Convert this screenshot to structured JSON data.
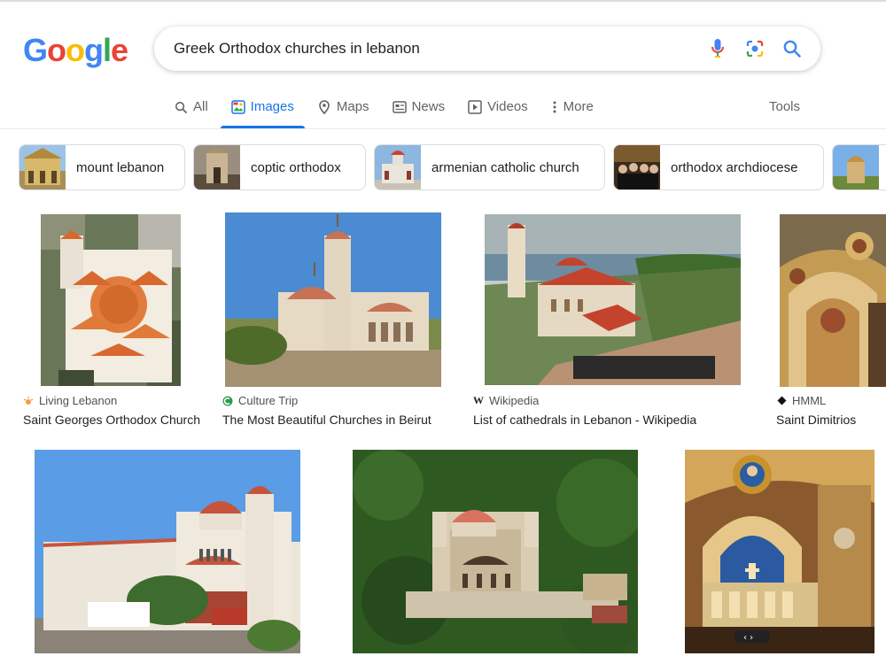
{
  "search": {
    "query": "Greek Orthodox churches in lebanon"
  },
  "logo": {
    "letters": [
      "G",
      "o",
      "o",
      "g",
      "l",
      "e"
    ],
    "colors": [
      "#4285F4",
      "#EA4335",
      "#FBBC05",
      "#4285F4",
      "#34A853",
      "#EA4335"
    ]
  },
  "tabs": [
    {
      "label": "All",
      "icon": "search-icon"
    },
    {
      "label": "Images",
      "icon": "images-icon"
    },
    {
      "label": "Maps",
      "icon": "map-pin-icon"
    },
    {
      "label": "News",
      "icon": "news-icon"
    },
    {
      "label": "Videos",
      "icon": "video-icon"
    },
    {
      "label": "More",
      "icon": "more-vertical-icon"
    }
  ],
  "tools_label": "Tools",
  "chips": [
    {
      "label": "mount lebanon"
    },
    {
      "label": "coptic orthodox"
    },
    {
      "label": "armenian catholic church"
    },
    {
      "label": "orthodox archdiocese"
    }
  ],
  "results": [
    {
      "source": "Living Lebanon",
      "title": "Saint Georges Orthodox Church"
    },
    {
      "source": "Culture Trip",
      "title": "The Most Beautiful Churches in Beirut"
    },
    {
      "source": "Wikipedia",
      "title": "List of cathedrals in Lebanon - Wikipedia"
    },
    {
      "source": "HMML",
      "title": "Saint Dimitrios"
    }
  ],
  "colors": {
    "accent": "#1a73e8",
    "mic_blue": "#4285F4",
    "lens_red": "#EA4335"
  }
}
